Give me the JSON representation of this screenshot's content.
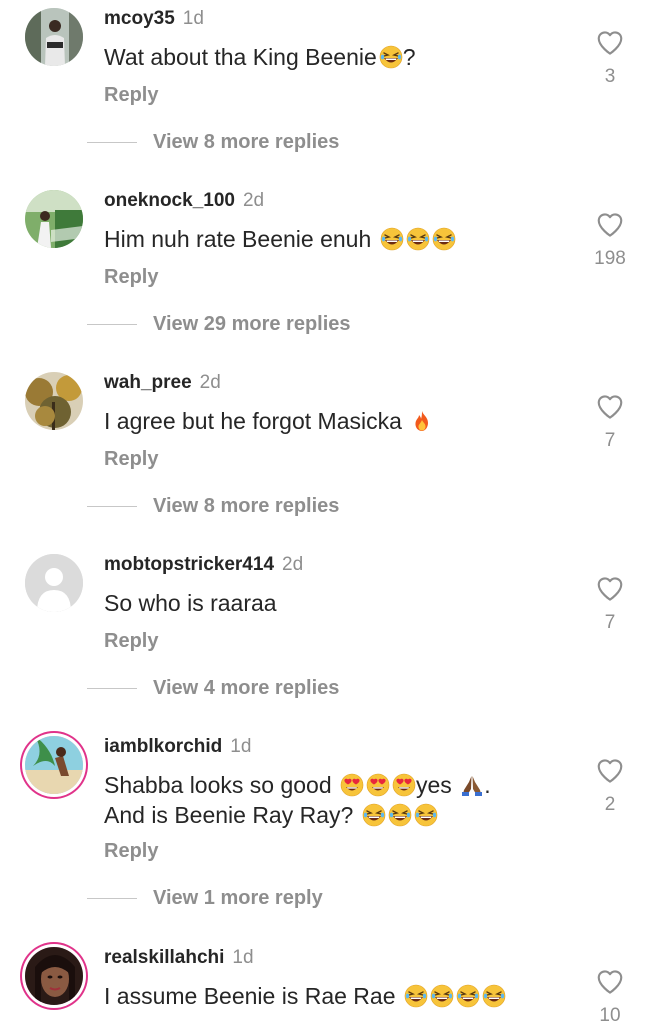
{
  "comments": [
    {
      "username": "mcoy35",
      "age": "1d",
      "text": "Wat about tha King Beenie",
      "suffix": "?",
      "emojis": 1,
      "reply": "Reply",
      "likes": "3",
      "view_more": "View 8 more replies"
    },
    {
      "username": "oneknock_100",
      "age": "2d",
      "text": "Him nuh rate Beenie enuh ",
      "suffix": "",
      "emojis": 3,
      "reply": "Reply",
      "likes": "198",
      "view_more": "View 29 more replies"
    },
    {
      "username": "wah_pree",
      "age": "2d",
      "text": "I agree but he forgot Masicka ",
      "suffix": "",
      "emojis": 0,
      "reply": "Reply",
      "likes": "7",
      "view_more": "View 8 more replies"
    },
    {
      "username": "mobtopstricker414",
      "age": "2d",
      "text": "So who is raaraa",
      "suffix": "",
      "emojis": 0,
      "reply": "Reply",
      "likes": "7",
      "view_more": "View 4 more replies"
    },
    {
      "username": "iamblkorchid",
      "age": "1d",
      "text_line1": "Shabba looks so good ",
      "text_line1_mid": "yes ",
      "text_line2": "And is Beenie Ray Ray? ",
      "reply": "Reply",
      "likes": "2",
      "view_more": "View 1 more reply"
    },
    {
      "username": "realskillahchi",
      "age": "1d",
      "text": "I assume Beenie is Rae Rae ",
      "suffix": "",
      "emojis": 4,
      "reply": "Reply",
      "likes": "10"
    }
  ]
}
